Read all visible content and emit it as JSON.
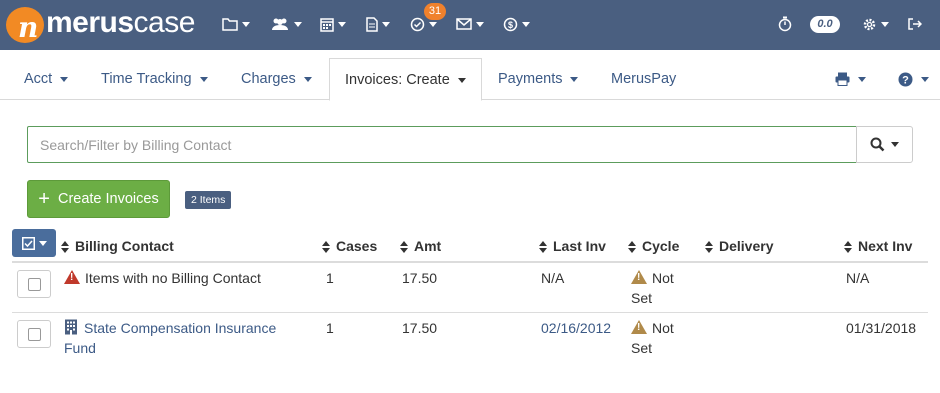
{
  "app": {
    "logo_brand": "merus",
    "logo_brand2": "case",
    "notifications_count": "31",
    "timer_value": "0.0",
    "icons": [
      "folder-icon",
      "users-icon",
      "calendar-icon",
      "document-icon",
      "check-circle-icon",
      "envelope-icon",
      "dollar-icon",
      "stopwatch-icon",
      "gear-icon",
      "sign-out-icon"
    ]
  },
  "tabs": [
    {
      "label": "Acct"
    },
    {
      "label": "Time Tracking"
    },
    {
      "label": "Charges"
    },
    {
      "label": "Invoices: Create"
    },
    {
      "label": "Payments"
    },
    {
      "label": "MerusPay"
    }
  ],
  "search": {
    "placeholder": "Search/Filter by Billing Contact"
  },
  "toolbar": {
    "create_label": "Create Invoices",
    "items_badge": "2 Items"
  },
  "table": {
    "columns": [
      "Billing Contact",
      "Cases",
      "Amt",
      "Last Inv",
      "Cycle",
      "Delivery",
      "Next Inv"
    ],
    "rows": [
      {
        "contact_line1": "Items with no Billing Contact",
        "contact_line2": "",
        "cases": "1",
        "amt": "17.50",
        "last_inv": "N/A",
        "cycle_line1": "Not",
        "cycle_line2": "Set",
        "delivery": "",
        "next_inv": "N/A"
      },
      {
        "contact_line1": "State Compensation Insurance",
        "contact_line2": "Fund",
        "cases": "1",
        "amt": "17.50",
        "last_inv": "02/16/2012",
        "cycle_line1": "Not",
        "cycle_line2": "Set",
        "delivery": "",
        "next_inv": "01/31/2018"
      }
    ]
  },
  "colors": {
    "topbar": "#4a5f80",
    "accent_orange": "#f28a24",
    "green": "#6cae45",
    "link": "#3c5a86"
  }
}
